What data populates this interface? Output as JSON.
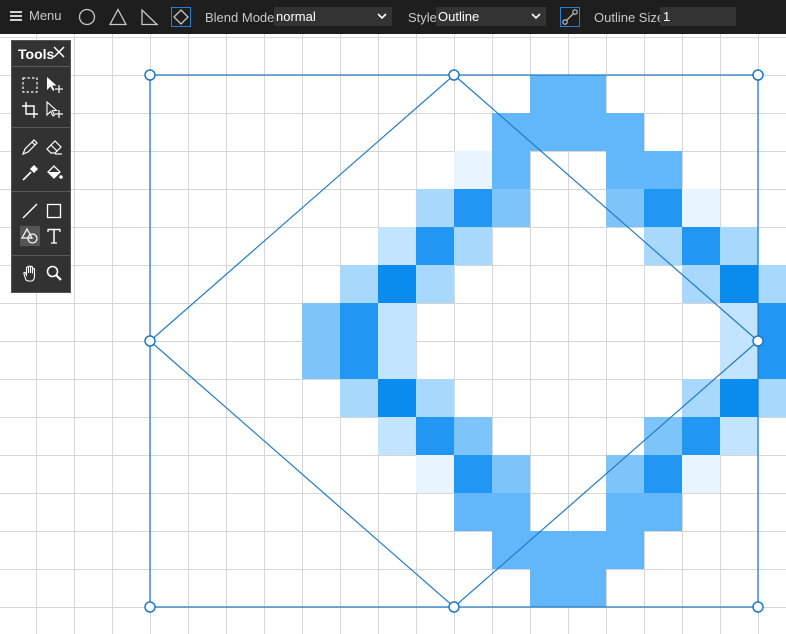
{
  "toolbar": {
    "menu_label": "Menu",
    "shape_tools": [
      {
        "icon": "circle-icon"
      },
      {
        "icon": "triangle-icon"
      },
      {
        "icon": "right-triangle-icon"
      },
      {
        "icon": "diamond-icon",
        "selected": true
      }
    ],
    "blend_mode": {
      "label": "Blend Mode:",
      "value": "normal"
    },
    "style": {
      "label": "Style:",
      "value": "Outline"
    },
    "outline_size": {
      "label": "Outline Size:",
      "value": "1"
    }
  },
  "tools_panel": {
    "title": "Tools",
    "groups": [
      [
        "marquee-select-icon",
        "move-selection-icon",
        "crop-icon",
        "move-icon"
      ],
      [
        "pencil-icon",
        "eraser-icon",
        "eyedropper-icon",
        "fill-bucket-icon"
      ],
      [
        "line-icon",
        "rectangle-icon",
        "shapes-icon",
        "text-icon"
      ],
      [
        "hand-icon",
        "zoom-icon"
      ]
    ],
    "active_tool": "shapes-icon"
  },
  "canvas": {
    "shape": "diamond",
    "pixel_colors": {
      "a": "#e8f4ff",
      "b": "#c2e4ff",
      "c": "#a8d8fb",
      "d": "#7dc4fa",
      "e": "#62b7fa",
      "f": "#2196f3",
      "g": "#0a8cef"
    },
    "pixel_rows": [
      "..........ee..........",
      ".........eeee.........",
      "........ae..ee........",
      ".......cfd..dfa.......",
      "......bfc....cfc......",
      ".....cgc......cgc.....",
      "....dfb........bfd....",
      "....dfb........bfd....",
      ".....cgc......cgc.....",
      "......bfd....dfb......",
      ".......afd..dfa.......",
      "........ee..ee........",
      ".........eeee.........",
      "..........ee.........."
    ],
    "selection_color": "#1f79c6",
    "grid_color": "#d6d6d6"
  }
}
